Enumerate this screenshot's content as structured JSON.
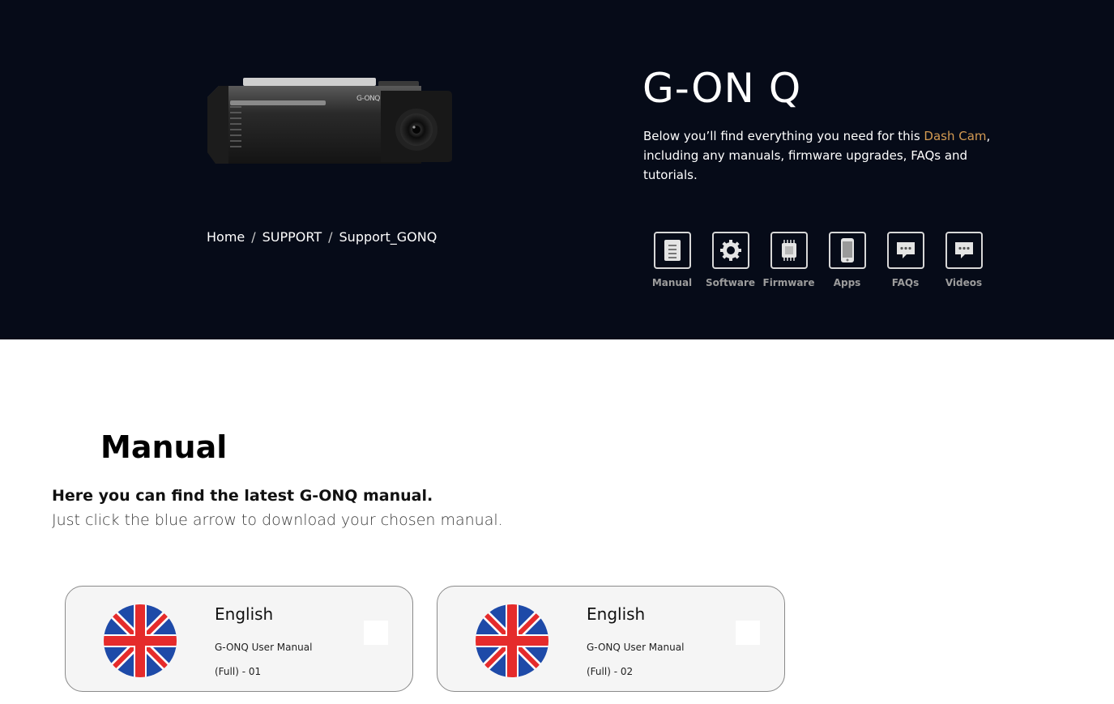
{
  "hero": {
    "product_title": "G-ON Q",
    "intro_before": "Below you’ll find everything you need for this ",
    "intro_highlight": "Dash Cam",
    "intro_after": ", including any manuals, firmware upgrades, FAQs and tutorials.",
    "product_badge": "G-ONQ"
  },
  "breadcrumb": {
    "home": "Home",
    "support": "SUPPORT",
    "current": "Support_GONQ",
    "separator": "/"
  },
  "support_nav": [
    {
      "label": "Manual",
      "icon": "manual-icon"
    },
    {
      "label": "Software",
      "icon": "gear-icon"
    },
    {
      "label": "Firmware",
      "icon": "chip-icon"
    },
    {
      "label": "Apps",
      "icon": "phone-icon"
    },
    {
      "label": "FAQs",
      "icon": "chat-icon"
    },
    {
      "label": "Videos",
      "icon": "chat-icon"
    }
  ],
  "manual_section": {
    "title": "Manual",
    "lead": "Here you can find the latest G-ONQ manual.",
    "sub": "Just click the blue arrow to download your chosen manual."
  },
  "manuals": [
    {
      "language": "English",
      "doc_title": "G-ONQ User Manual",
      "doc_part": "(Full) - 01",
      "flag": "uk-flag-icon"
    },
    {
      "language": "English",
      "doc_title": "G-ONQ User Manual",
      "doc_part": "(Full) - 02",
      "flag": "uk-flag-icon"
    }
  ],
  "colors": {
    "hero_bg": "#060b18",
    "accent": "#d39a52",
    "nav_label": "#9c9c9c",
    "card_bg": "#f5f5f5"
  }
}
